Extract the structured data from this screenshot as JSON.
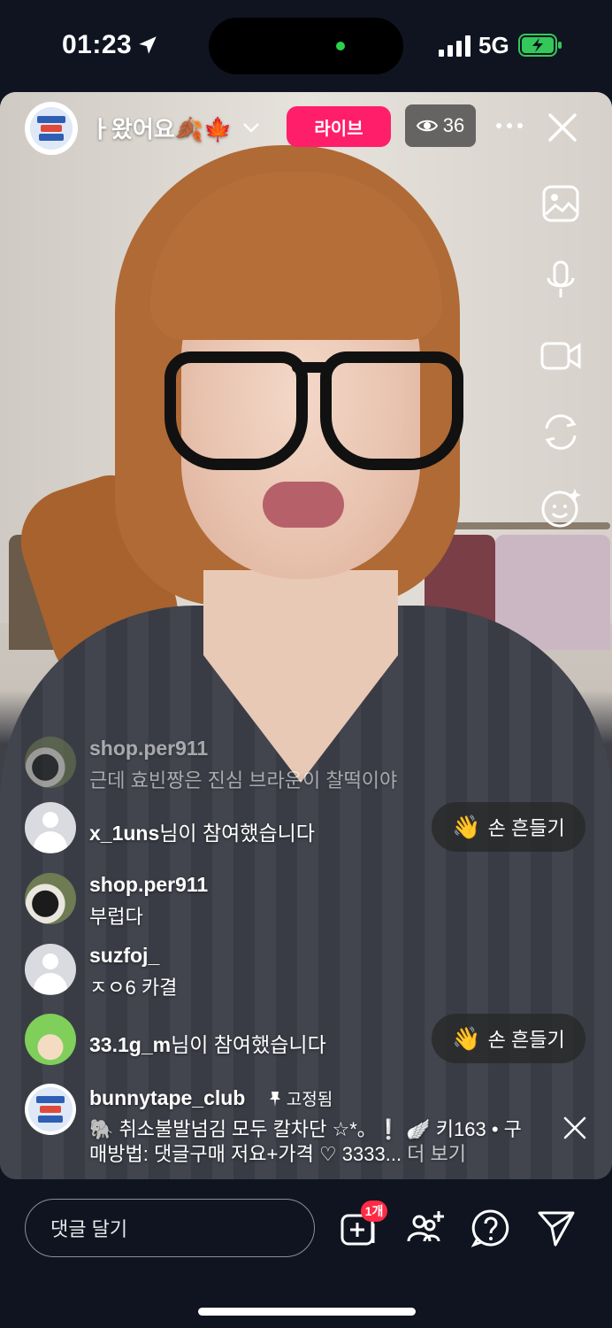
{
  "status_bar": {
    "time": "01:23",
    "network": "5G"
  },
  "header": {
    "title": "ㅏ왔어요🍂🍁",
    "live_label": "라이브",
    "viewer_count": "36"
  },
  "comments": [
    {
      "user": "shop.per911",
      "text": "근데 효빈짱은 진심 브라운이 찰떡이야",
      "faded": true
    },
    {
      "join_user": "x_1uns",
      "join_suffix": "님이 참여했습니다",
      "wave_label": "손 흔들기"
    },
    {
      "user": "shop.per911",
      "text": "부럽다"
    },
    {
      "user": "suzfoj_",
      "text": "ㅈㅇ6 카결"
    },
    {
      "join_user": "33.1g_m",
      "join_suffix": "님이 참여했습니다",
      "wave_label": "손 흔들기"
    }
  ],
  "pinned": {
    "user": "bunnytape_club",
    "tag": "고정됨",
    "line1": "🐘 취소불발넘김 모두 칼차단 ☆*。❕ 🪽 키163 • 구",
    "line2_prefix": "매방법: 댓글구매 저요+가격 ♡ 3333... ",
    "line2_more": "더 보기"
  },
  "bottom_bar": {
    "comment_placeholder": "댓글 달기",
    "badge": "1개"
  },
  "icons": [
    "location-arrow-icon",
    "signal-icon",
    "battery-icon",
    "chevron-down-icon",
    "eye-icon",
    "more-icon",
    "close-icon",
    "gallery-icon",
    "microphone-icon",
    "video-camera-icon",
    "flip-camera-icon",
    "effects-icon",
    "add-media-icon",
    "add-guest-icon",
    "question-icon",
    "send-icon"
  ],
  "colors": {
    "live_badge": "#ff1e6a",
    "notification_badge": "#ff2b44",
    "battery": "#34c759"
  }
}
